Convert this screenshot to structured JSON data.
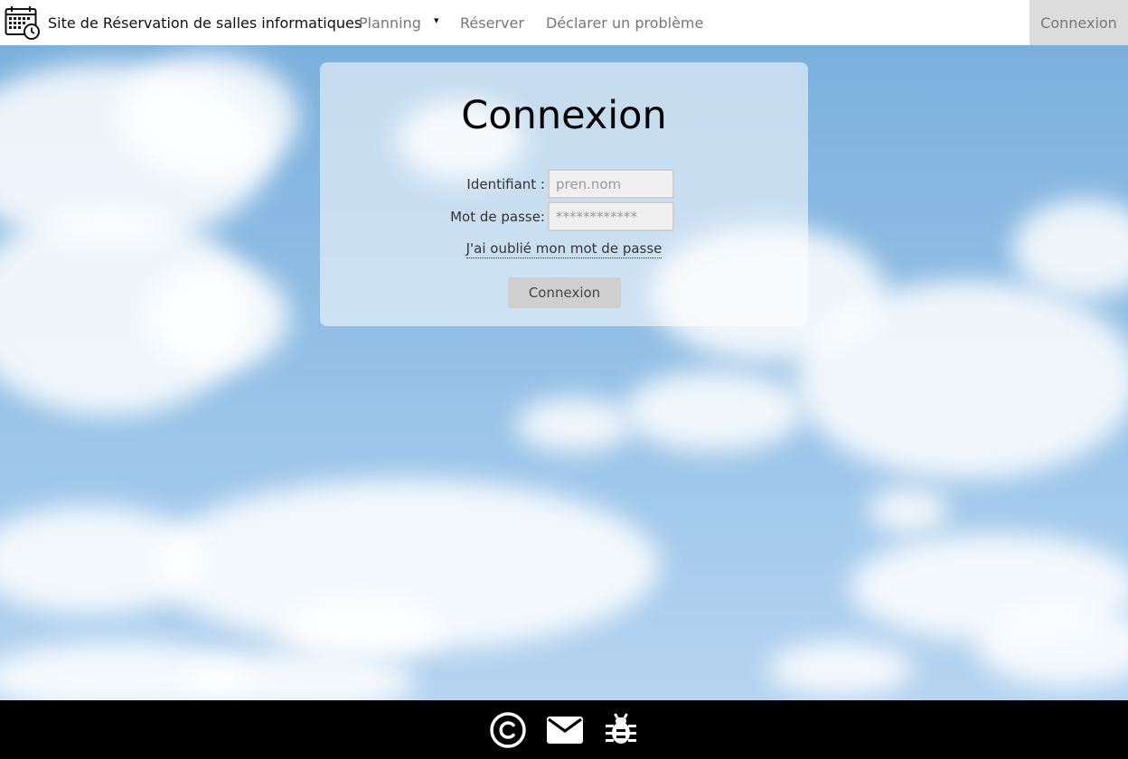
{
  "navbar": {
    "title": "Site de Réservation de salles informatiques",
    "planning": "Planning",
    "planning_caret": "▾",
    "reserver": "Réserver",
    "declarer": "Déclarer un problème",
    "login": "Connexion"
  },
  "login_card": {
    "title": "Connexion",
    "username_label": "Identifiant :",
    "username_placeholder": "pren.nom",
    "password_label": "Mot de passe:",
    "password_placeholder": "************",
    "forgot_link": "J'ai oublié mon mot de passe",
    "submit_label": "Connexion"
  },
  "footer": {
    "icons": [
      "copyright-icon",
      "mail-icon",
      "bug-icon"
    ]
  },
  "colors": {
    "navbar_bg": "#ffffff",
    "nav_active_bg": "#dcdcdc",
    "footer_bg": "#000000",
    "button_bg": "#cfcfcf"
  }
}
